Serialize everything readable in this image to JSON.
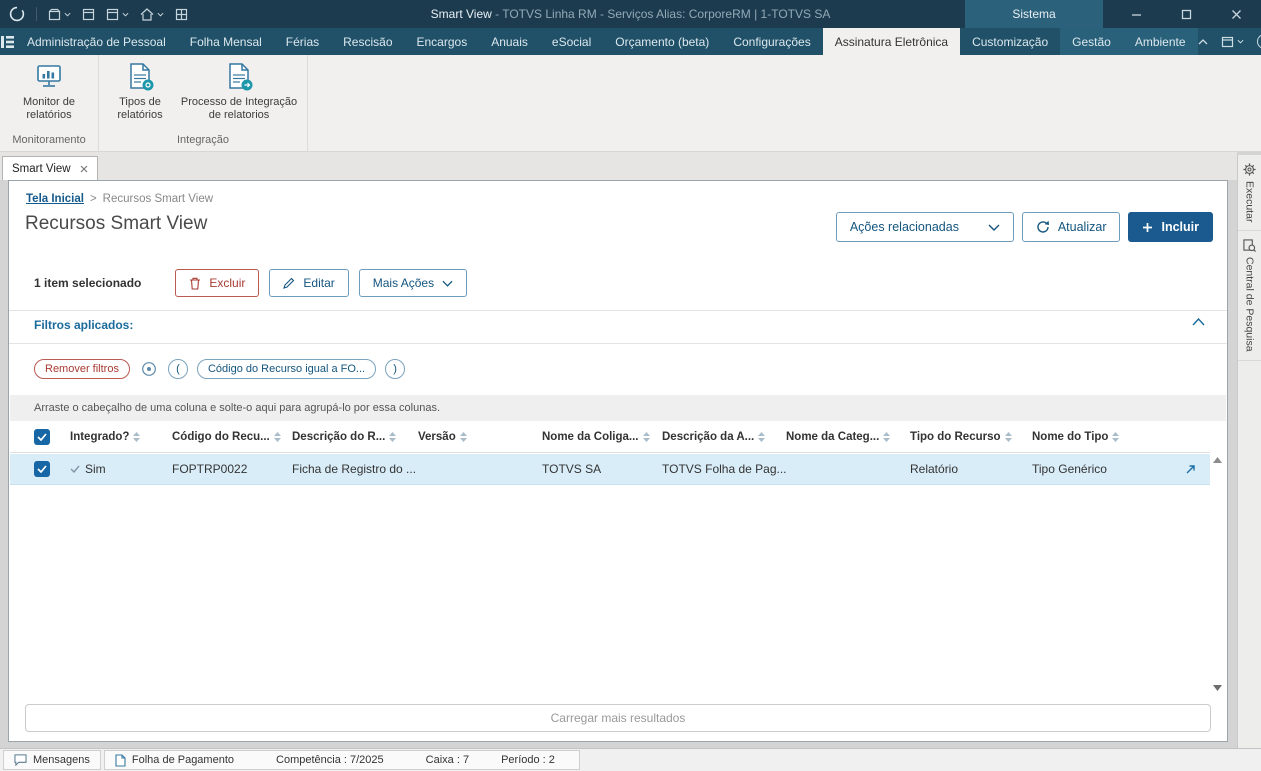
{
  "titlebar": {
    "app_title": "Smart View",
    "window_subtitle": " - TOTVS Linha RM - Serviços  Alias: CorporeRM | 1-TOTVS SA",
    "context_group": "Sistema"
  },
  "menubar": {
    "items": [
      {
        "label": "Administração de Pessoal"
      },
      {
        "label": "Folha Mensal"
      },
      {
        "label": "Férias"
      },
      {
        "label": "Rescisão"
      },
      {
        "label": "Encargos"
      },
      {
        "label": "Anuais"
      },
      {
        "label": "eSocial"
      },
      {
        "label": "Orçamento (beta)"
      },
      {
        "label": "Configurações"
      },
      {
        "label": "Assinatura Eletrônica"
      },
      {
        "label": "Customização"
      },
      {
        "label": "Gestão"
      },
      {
        "label": "Ambiente"
      }
    ]
  },
  "ribbon": {
    "groups": [
      {
        "label": "Monitoramento",
        "items": [
          {
            "label": "Monitor de relatórios"
          }
        ]
      },
      {
        "label": "Integração",
        "items": [
          {
            "label": "Tipos de relatórios"
          },
          {
            "label": "Processo de Integração de relatorios"
          }
        ]
      }
    ]
  },
  "document_tab": {
    "label": "Smart View"
  },
  "page": {
    "breadcrumb": {
      "home": "Tela Inicial",
      "separator": ">",
      "current": "Recursos Smart View"
    },
    "title": "Recursos Smart View",
    "header_actions": {
      "related": "Ações relacionadas",
      "refresh": "Atualizar",
      "include": "Incluir"
    },
    "selection": {
      "label": "1 item selecionado",
      "delete": "Excluir",
      "edit": "Editar",
      "more": "Mais Ações"
    },
    "filters": {
      "title": "Filtros aplicados:",
      "remove": "Remover filtros",
      "open_paren": "(",
      "chip": "Código do Recurso igual a FO...",
      "close_paren": ")"
    },
    "group_hint": "Arraste o cabeçalho de uma coluna e solte-o aqui para agrupá-lo por essa colunas.",
    "load_more": "Carregar mais resultados"
  },
  "table": {
    "columns": [
      "Integrado?",
      "Código do Recu...",
      "Descrição do R...",
      "Versão",
      "Nome da Coliga...",
      "Descrição da A...",
      "Nome da Categ...",
      "Tipo do Recurso",
      "Nome do Tipo"
    ],
    "rows": [
      {
        "integrado": "Sim",
        "codigo": "FOPTRP0022",
        "descricao": "Ficha de Registro do ...",
        "versao": "",
        "coligada": "TOTVS SA",
        "descricao_app": "TOTVS Folha de Pag...",
        "categoria": "",
        "tipo_recurso": "Relatório",
        "nome_tipo": "Tipo Genérico"
      }
    ]
  },
  "right_rail": {
    "items": [
      {
        "label": "Executar"
      },
      {
        "label": "Central de Pesquisa"
      }
    ]
  },
  "statusbar": {
    "messages": "Mensagens",
    "module": "Folha de Pagamento",
    "competencia": "Competência : 7/2025",
    "caixa": "Caixa : 7",
    "periodo": "Período : 2"
  }
}
